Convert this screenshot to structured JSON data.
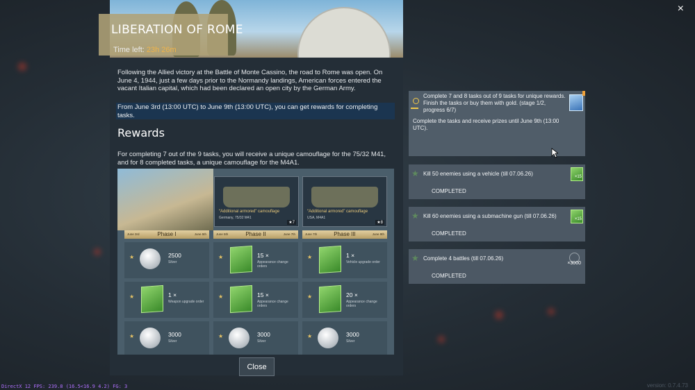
{
  "window": {
    "close_icon": "×",
    "fps": "DirectX 12 FPS: 239.8 (16.5<16.9 4.2) FG: 3",
    "version": "version: 0.7.4.73"
  },
  "event": {
    "title": "LIBERATION OF ROME",
    "time_left_label": "Time left:",
    "time_left_value": "23h 26m",
    "description": "Following the Allied victory at the Battle of Monte Cassino, the road to Rome was open. On June 4, 1944, just a few days prior to the Normandy landings, American forces entered the vacant Italian capital, which had been declared an open city by the German Army.",
    "period": "From June 3rd (13:00 UTC) to June 9th (13:00 UTC), you can get rewards for completing tasks.",
    "rewards_heading": "Rewards",
    "rewards_text": "For completing 7 out of the 9 tasks, you will receive a unique camouflage for the 75/32 M41, and for 8 completed tasks, a unique camouflage for the M4A1."
  },
  "camo_cards": [
    {
      "caption": "“Additional armored” camouflage",
      "vehicle": "Germany, 75/32 M41",
      "stars": "★7"
    },
    {
      "caption": "“Additional armored” camouflage",
      "vehicle": "USA, M4A1",
      "stars": "★8"
    }
  ],
  "phases": [
    {
      "name": "Phase I",
      "start": "June 3rd",
      "end": "June 5th"
    },
    {
      "name": "Phase II",
      "start": "June 5th",
      "end": "June 7th"
    },
    {
      "name": "Phase III",
      "start": "June 7th",
      "end": "June 9th"
    }
  ],
  "reward_grid": [
    [
      {
        "icon": "silver-coins-icon",
        "value": "2500",
        "label": "Silver"
      },
      {
        "icon": "appearance-order-icon",
        "value": "15 ×",
        "label": "Appearance change orders"
      },
      {
        "icon": "vehicle-upgrade-order-icon",
        "value": "1 ×",
        "label": "Vehicle upgrade order"
      }
    ],
    [
      {
        "icon": "weapon-upgrade-order-icon",
        "value": "1 ×",
        "label": "Weapon upgrade order"
      },
      {
        "icon": "appearance-order-icon",
        "value": "15 ×",
        "label": "Appearance change orders"
      },
      {
        "icon": "appearance-order-icon",
        "value": "20 ×",
        "label": "Appearance change orders"
      }
    ],
    [
      {
        "icon": "silver-coins-icon",
        "value": "3000",
        "label": "Silver"
      },
      {
        "icon": "silver-coins-icon",
        "value": "3000",
        "label": "Silver"
      },
      {
        "icon": "silver-coins-icon",
        "value": "3000",
        "label": "Silver"
      }
    ]
  ],
  "close_button": "Close",
  "progress": {
    "text": "Complete 7 and 8 tasks out of 9 tasks for unique rewards. Finish the tasks or buy them with gold. (stage 1/2, progress 6/7)",
    "text2": "Complete the tasks and receive prizes until June 9th (13:00 UTC)."
  },
  "tasks": [
    {
      "name": "Kill 50 enemies using a vehicle (till 07.06.26)",
      "status": "COMPLETED",
      "reward": "×15"
    },
    {
      "name": "Kill 60 enemies using a submachine gun (till 07.06.26)",
      "status": "COMPLETED",
      "reward": "×15"
    },
    {
      "name": "Complete 4 battles (till 07.06.26)",
      "status": "COMPLETED",
      "reward": "×3000"
    }
  ]
}
